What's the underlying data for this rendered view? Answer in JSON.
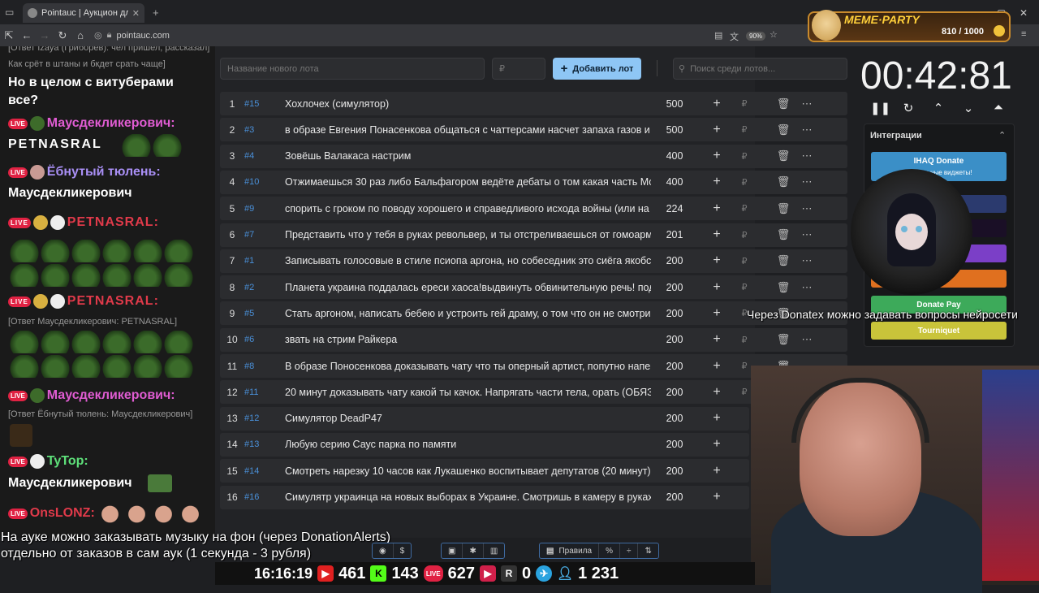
{
  "browser": {
    "tab_title": "Pointauc | Аукцион для стримеров",
    "url": "pointauc.com",
    "zoom": "90%"
  },
  "chat": {
    "lines": [
      {
        "text": "[Ответ Izaya (Гриборев): чел пришел, рассказал]"
      },
      {
        "text": "Как срёт в штаны и бкдет срать чаще]"
      }
    ],
    "msg1_a": "Но в целом с витуберами",
    "msg1_b": "все?",
    "user1": "Маусдекликерович:",
    "user1_msg": "PETNASRAL",
    "user2": "Ёбнутый тюлень:",
    "user2_msg": "Маусдекликерович",
    "user3": "PETNASRAL:",
    "user4": "PETNASRAL:",
    "reply4": "[Ответ Маусдекликерович: PETNASRAL]",
    "user5": "Маусдекликерович:",
    "reply5": "[Ответ Ёбнутый тюлень: Маусдекликерович]",
    "user6": "TyTop:",
    "user6_msg": "Маусдекликерович",
    "user7": "OnsLONZ:"
  },
  "auction": {
    "new_lot_placeholder": "Название нового лота",
    "price_placeholder": "₽",
    "add_label": "Добавить лот",
    "search_placeholder": "Поиск среди лотов...",
    "lots": [
      {
        "n": "1",
        "id": "#15",
        "name": "Хохлочех (симулятор)",
        "amount": "500"
      },
      {
        "n": "2",
        "id": "#3",
        "name": "в образе Евгения Понасенкова общаться с чаттерсами насчет запаха газов и i",
        "amount": "500"
      },
      {
        "n": "3",
        "id": "#4",
        "name": "Зовёшь Валакаса настрим",
        "amount": "400"
      },
      {
        "n": "4",
        "id": "#10",
        "name": "Отжимаешься 30 раз либо Бальфагором ведёте дебаты о том какая часть Мор",
        "amount": "400"
      },
      {
        "n": "5",
        "id": "#9",
        "name": "спорить с гроком по поводу хорошего и справедливого исхода войны (или на",
        "amount": "224"
      },
      {
        "n": "6",
        "id": "#7",
        "name": "Представить что у тебя в руках револьвер, и ты отстреливаешься от гомоарм",
        "amount": "201"
      },
      {
        "n": "7",
        "id": "#1",
        "name": "Записывать голосовые в стиле псиопа аргона, но собеседник это сиёга якобс",
        "amount": "200"
      },
      {
        "n": "8",
        "id": "#2",
        "name": "Планета украина поддалась ереси хаоса!выдвинуть обвинительную речь! под",
        "amount": "200"
      },
      {
        "n": "9",
        "id": "#5",
        "name": "Стать аргоном, написать бебею и устроить гей драму, о том что он не смотри",
        "amount": "200"
      },
      {
        "n": "10",
        "id": "#6",
        "name": "звать на стрим Райкера",
        "amount": "200"
      },
      {
        "n": "11",
        "id": "#8",
        "name": "В образе Поносенкова доказывать чату что ты оперный артист, попутно напев",
        "amount": "200"
      },
      {
        "n": "12",
        "id": "#11",
        "name": "20 минут доказывать чату какой ты качок. Напрягать части тела, орать (ОБЯЗ.",
        "amount": "200"
      },
      {
        "n": "13",
        "id": "#12",
        "name": "Симулятор DeadP47",
        "amount": "200"
      },
      {
        "n": "14",
        "id": "#13",
        "name": "Любую серию Саус парка по памяти",
        "amount": "200"
      },
      {
        "n": "15",
        "id": "#14",
        "name": "Смотреть нарезку 10 часов как Лукашенко воспитывает депутатов (20 минут)",
        "amount": "200"
      },
      {
        "n": "16",
        "id": "#16",
        "name": "Симулятр украинца на новых выборах в Украине. Смотришь в камеру в руках",
        "amount": "200"
      }
    ]
  },
  "timer": {
    "value": "00:42:81"
  },
  "integrations": {
    "title": "Интеграции",
    "items": [
      {
        "label": "IHAQ Donate",
        "color": "#3b8fc7"
      },
      {
        "label": "er",
        "color": "#2b3a6e"
      },
      {
        "label": "",
        "color": "#1a0f26"
      },
      {
        "label": "",
        "color": "#7b3fc7"
      },
      {
        "label": "Alerts",
        "color": "#e0701f"
      },
      {
        "label": "Donate Pay",
        "color": "#3daa5a"
      },
      {
        "label": "Tourniquet",
        "color": "#c9c43a"
      }
    ],
    "subtitle": "Уникальные виджеты!"
  },
  "meme": {
    "title": "MEME·PARTY",
    "count": "810 / 1000"
  },
  "overlay": {
    "donatex": "Через Donatex можно задавать вопросы нейросети",
    "music1": "На ауке можно заказывать музыку на фон (через DonationAlerts)",
    "music2": "отдельно от заказов в сам аук (1 секунда - 3 рубля)"
  },
  "toolbar": {
    "rules": "Правила"
  },
  "stats": {
    "time": "16:16:19",
    "youtube": "461",
    "kick": "143",
    "vk": "627",
    "r": "0",
    "viewers": "1 231"
  }
}
